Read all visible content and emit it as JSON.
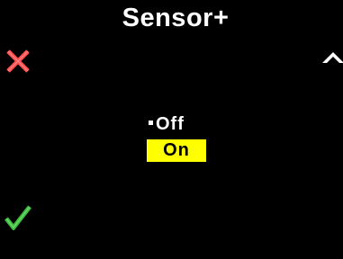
{
  "screen": {
    "title": "Sensor+",
    "background_color": "#000000"
  },
  "softkeys": {
    "cancel_icon": "cross-icon",
    "cancel_color": "#ff4c4c",
    "up_icon": "chevron-up-icon",
    "up_color": "#ffffff",
    "confirm_icon": "checkmark-icon",
    "confirm_color": "#3cbf3c"
  },
  "options": {
    "items": [
      {
        "label": "Off",
        "current": true,
        "highlighted": false
      },
      {
        "label": "On",
        "current": false,
        "highlighted": true
      }
    ],
    "highlight_color": "#ffff00"
  }
}
